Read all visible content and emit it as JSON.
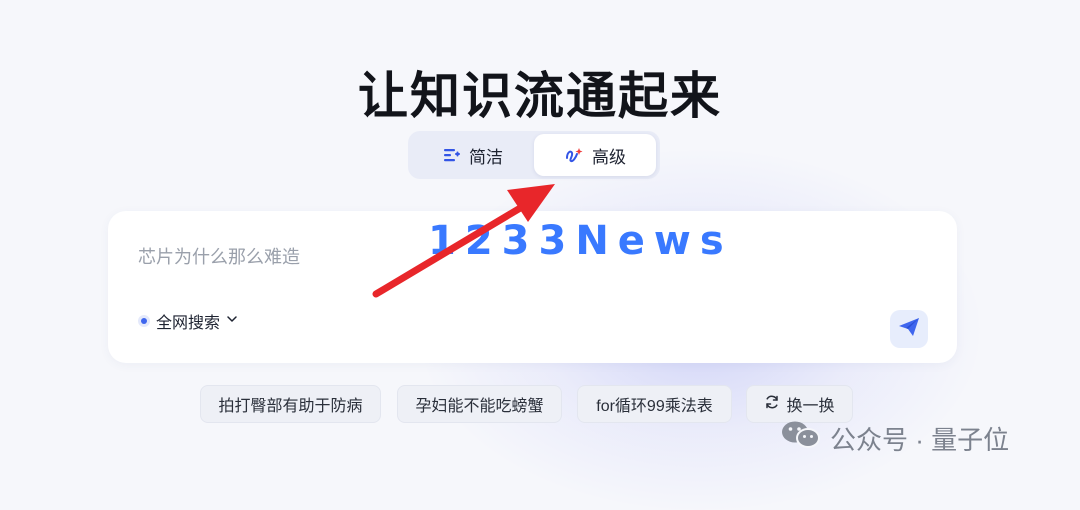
{
  "title": "让知识流通起来",
  "mode_switch": {
    "simple_label": "简洁",
    "advanced_label": "高级",
    "selected": "高级"
  },
  "search": {
    "placeholder": "芯片为什么那么难造",
    "value": "",
    "scope_label": "全网搜索"
  },
  "suggestions": {
    "items": [
      "拍打臀部有助于防病",
      "孕妇能不能吃螃蟹",
      "for循环99乘法表"
    ],
    "refresh_label": "换一换"
  },
  "overlay": {
    "watermark_text": "1233News",
    "arrow_color": "#e8262a",
    "credit_text": "公众号 · 量子位"
  },
  "colors": {
    "accent": "#3f66ee",
    "background": "#f6f7fb",
    "watermark": "#2f72ff"
  },
  "icons": {
    "simple": "list-lines-icon",
    "advanced": "sparkle-pen-icon",
    "scope": "dot-icon",
    "dropdown": "chevron-down-icon",
    "send": "paper-plane-icon",
    "refresh": "refresh-icon",
    "credit": "wechat-icon"
  }
}
